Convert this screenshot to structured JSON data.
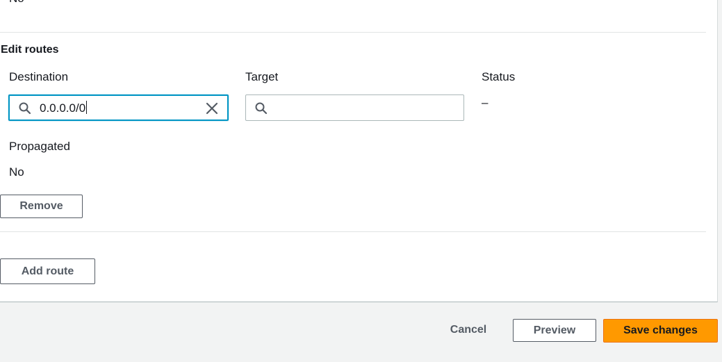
{
  "top_value": "No",
  "section": {
    "title": "Edit routes"
  },
  "columns": {
    "destination": "Destination",
    "target": "Target",
    "status": "Status",
    "propagated": "Propagated"
  },
  "route": {
    "destination_value": "0.0.0.0/0",
    "target_value": "",
    "status_value": "–",
    "propagated_value": "No"
  },
  "buttons": {
    "remove": "Remove",
    "add_route": "Add route",
    "cancel": "Cancel",
    "preview": "Preview",
    "save_changes": "Save changes"
  },
  "colors": {
    "primary_button": "#ff9900",
    "focus_border": "#0095c4"
  }
}
